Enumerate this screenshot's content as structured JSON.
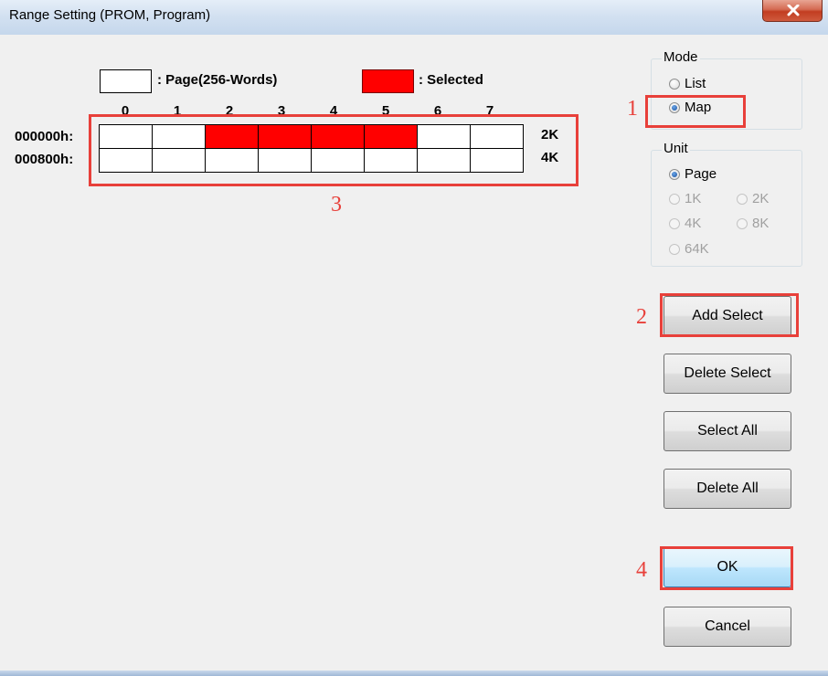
{
  "window": {
    "title": "Range Setting (PROM, Program)"
  },
  "legend": {
    "page_label": ": Page(256-Words)",
    "selected_label": ": Selected",
    "selected_color": "#ff0000"
  },
  "map": {
    "columns": [
      "0",
      "1",
      "2",
      "3",
      "4",
      "5",
      "6",
      "7"
    ],
    "rows": [
      {
        "address": "000000h:",
        "size": "2K",
        "selected": [
          false,
          false,
          true,
          true,
          true,
          true,
          false,
          false
        ]
      },
      {
        "address": "000800h:",
        "size": "4K",
        "selected": [
          false,
          false,
          false,
          false,
          false,
          false,
          false,
          false
        ]
      }
    ]
  },
  "mode": {
    "title": "Mode",
    "options": [
      "List",
      "Map"
    ],
    "selected": "Map"
  },
  "unit": {
    "title": "Unit",
    "options": [
      "Page",
      "1K",
      "2K",
      "4K",
      "8K",
      "64K"
    ],
    "selected": "Page"
  },
  "buttons": {
    "add_select": "Add Select",
    "delete_select": "Delete Select",
    "select_all": "Select All",
    "delete_all": "Delete All",
    "ok": "OK",
    "cancel": "Cancel"
  },
  "annotations": {
    "n1": "1",
    "n2": "2",
    "n3": "3",
    "n4": "4",
    "color": "#e8403a"
  },
  "icons": {
    "close": "close-icon"
  }
}
